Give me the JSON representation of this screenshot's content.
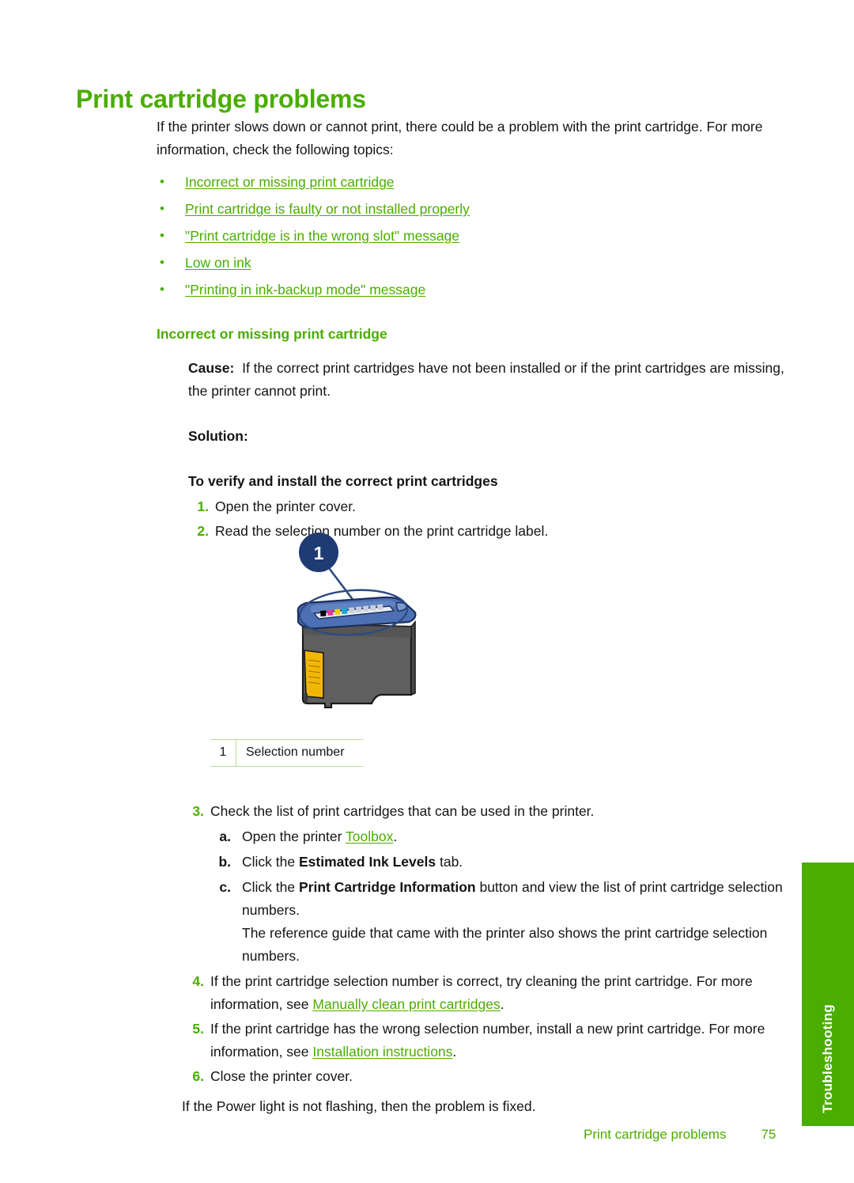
{
  "page": {
    "title": "Print cartridge problems",
    "intro": "If the printer slows down or cannot print, there could be a problem with the print cartridge. For more information, check the following topics:",
    "accent_green": "#4aad00",
    "rule_green": "#b9dd94",
    "text_black": "#141414"
  },
  "topic_links": [
    {
      "label": "Incorrect or missing print cartridge"
    },
    {
      "label": "Print cartridge is faulty or not installed properly"
    },
    {
      "label": "\"Print cartridge is in the wrong slot\" message"
    },
    {
      "label": "Low on ink"
    },
    {
      "label": "\"Printing in ink-backup mode\" message"
    }
  ],
  "section": {
    "heading": "Incorrect or missing print cartridge",
    "cause_label": "Cause:",
    "cause_text": "If the correct print cartridges have not been installed or if the print cartridges are missing, the printer cannot print.",
    "solution_label": "Solution:",
    "procedure_title": "To verify and install the correct print cartridges"
  },
  "steps_upper": [
    {
      "num": "1.",
      "text": "Open the printer cover."
    },
    {
      "num": "2.",
      "text": "Read the selection number on the print cartridge label."
    }
  ],
  "figure": {
    "callout_number": "1",
    "alt": "print cartridge with selection number label on top",
    "colors": {
      "callout_circle": "#1f3b73",
      "cartridge_body": "#636363",
      "cartridge_body_dark": "#4a4a4a",
      "cartridge_top": "#4a6fb5",
      "label_yellow": "#f2b705"
    }
  },
  "caption_table": {
    "rows": [
      {
        "num": "1",
        "text": "Selection number"
      }
    ]
  },
  "steps_lower": [
    {
      "num": "3.",
      "text": "Check the list of print cartridges that can be used in the printer.",
      "substeps": [
        {
          "alpha": "a.",
          "pre": "Open the printer ",
          "link": "Toolbox",
          "post": "."
        },
        {
          "alpha": "b.",
          "pre": "Click the ",
          "bold": "Estimated Ink Levels",
          "post": " tab."
        },
        {
          "alpha": "c.",
          "pre": "Click the ",
          "bold": "Print Cartridge Information",
          "post": " button and view the list of print cartridge selection numbers.",
          "note": "The reference guide that came with the printer also shows the print cartridge selection numbers."
        }
      ]
    },
    {
      "num": "4.",
      "pre": "If the print cartridge selection number is correct, try cleaning the print cartridge. For more information, see ",
      "link": "Manually clean print cartridges",
      "post": "."
    },
    {
      "num": "5.",
      "pre": "If the print cartridge has the wrong selection number, install a new print cartridge. For more information, see ",
      "link": "Installation instructions",
      "post": "."
    },
    {
      "num": "6.",
      "text": "Close the printer cover."
    }
  ],
  "closing_text": "If the Power light is not flashing, then the problem is fixed.",
  "side_tab": {
    "label": "Troubleshooting"
  },
  "footer": {
    "title": "Print cartridge problems",
    "page_number": "75"
  }
}
